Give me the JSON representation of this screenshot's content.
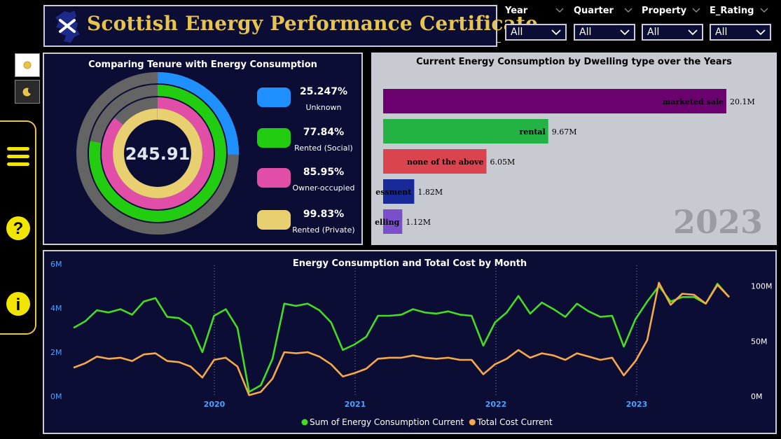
{
  "header": {
    "title": "Scottish Energy Performance Certificate"
  },
  "filters": [
    {
      "label": "Year",
      "value": "All"
    },
    {
      "label": "Quarter",
      "value": "All"
    },
    {
      "label": "Property",
      "value": "All"
    },
    {
      "label": "E_Rating",
      "value": "All"
    }
  ],
  "theme": {
    "light_icon": "sun-icon",
    "dark_icon": "moon-icon"
  },
  "sidebar": {
    "icons": [
      "menu-icon",
      "help-icon",
      "info-icon"
    ]
  },
  "tenure_chart": {
    "title": "Comparing Tenure with Energy Consumption",
    "center_value": "245.91",
    "items": [
      {
        "value": "25.247%",
        "label": "Unknown",
        "color": "#1e90ff",
        "fraction": 0.25247
      },
      {
        "value": "77.84%",
        "label": "Rented (Social)",
        "color": "#22cc11",
        "fraction": 0.7784
      },
      {
        "value": "85.95%",
        "label": "Owner-occupied",
        "color": "#e04ea8",
        "fraction": 0.8595
      },
      {
        "value": "99.83%",
        "label": "Rented (Private)",
        "color": "#e8d070",
        "fraction": 0.9983
      }
    ]
  },
  "dwelling_chart": {
    "title": "Current Energy Consumption by Dwelling type over the Years",
    "year": "2023",
    "bars": [
      {
        "label": "marketed sale",
        "value": 20.1,
        "display": "20.1M",
        "color": "#6b006f"
      },
      {
        "label": "rental",
        "value": 9.67,
        "display": "9.67M",
        "color": "#22b344"
      },
      {
        "label": "none of the above",
        "value": 6.05,
        "display": "6.05M",
        "color": "#d9444e"
      },
      {
        "label": "essment",
        "value": 1.82,
        "display": "1.82M",
        "color": "#182a9a"
      },
      {
        "label": "elling",
        "value": 1.12,
        "display": "1.12M",
        "color": "#7a4fc9"
      }
    ]
  },
  "chart_data": {
    "type": "line",
    "title": "Energy Consumption and Total Cost by Month",
    "x_ticks": [
      "2020",
      "2021",
      "2022",
      "2023"
    ],
    "y_left_ticks": [
      "6M",
      "4M",
      "2M",
      "0M"
    ],
    "y_right_ticks": [
      "100M",
      "50M",
      "0M"
    ],
    "ylim_left": [
      0,
      6
    ],
    "ylim_right": [
      0,
      120
    ],
    "series": [
      {
        "name": "Sum of Energy Consumption Current",
        "axis": "left",
        "color": "#44dd22",
        "values": [
          3.1,
          3.4,
          3.9,
          3.8,
          3.95,
          3.7,
          4.3,
          4.45,
          3.6,
          3.55,
          3.2,
          2.0,
          3.65,
          3.95,
          3.1,
          0.2,
          0.5,
          1.7,
          4.2,
          4.1,
          4.2,
          3.9,
          3.35,
          2.1,
          2.35,
          2.7,
          3.65,
          3.65,
          3.7,
          3.95,
          3.8,
          3.75,
          3.85,
          3.7,
          3.65,
          2.3,
          3.35,
          3.8,
          4.55,
          3.75,
          4.25,
          3.95,
          3.6,
          4.2,
          3.85,
          3.6,
          3.65,
          2.25,
          3.5,
          4.3,
          5.0,
          4.3,
          4.5,
          4.5,
          4.2,
          5.1,
          4.5
        ]
      },
      {
        "name": "Total Cost Current",
        "axis": "right",
        "color": "#f5a94a",
        "values": [
          26,
          30,
          36,
          34,
          35,
          32,
          38,
          39,
          32,
          31,
          27,
          17,
          33,
          35,
          27,
          1,
          4,
          16,
          40,
          39,
          40,
          36,
          29,
          18,
          21,
          25,
          34,
          35,
          35,
          37,
          35,
          34,
          35,
          33,
          33,
          20,
          29,
          34,
          42,
          35,
          39,
          37,
          33,
          39,
          36,
          33,
          35,
          19,
          32,
          51,
          103,
          83,
          93,
          92,
          84,
          101,
          90
        ]
      }
    ]
  }
}
